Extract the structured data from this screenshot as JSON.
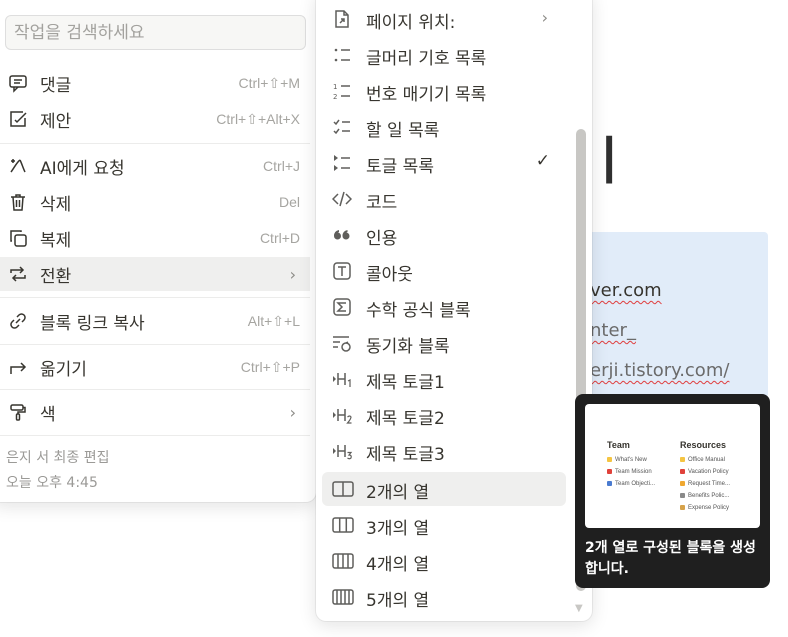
{
  "background": {
    "heading_fragment": "ㅣ",
    "links": [
      "ver.com",
      "nter_",
      "erji.tistory.com/"
    ]
  },
  "left_menu": {
    "search_placeholder": "작업을 검색하세요",
    "items": [
      {
        "label": "댓글",
        "shortcut": "Ctrl+⇧+M"
      },
      {
        "label": "제안",
        "shortcut": "Ctrl+⇧+Alt+X"
      },
      {
        "label": "AI에게 요청",
        "shortcut": "Ctrl+J"
      },
      {
        "label": "삭제",
        "shortcut": "Del"
      },
      {
        "label": "복제",
        "shortcut": "Ctrl+D"
      },
      {
        "label": "전환",
        "shortcut": ""
      },
      {
        "label": "블록 링크 복사",
        "shortcut": "Alt+⇧+L"
      },
      {
        "label": "옮기기",
        "shortcut": "Ctrl+⇧+P"
      },
      {
        "label": "색",
        "shortcut": ""
      }
    ],
    "footer": {
      "editor": "은지 서 최종 편집",
      "time": "오늘 오후 4:45"
    }
  },
  "turn_into_menu": {
    "items": [
      {
        "label": "페이지 위치:"
      },
      {
        "label": "글머리 기호 목록"
      },
      {
        "label": "번호 매기기 목록"
      },
      {
        "label": "할 일 목록"
      },
      {
        "label": "토글 목록"
      },
      {
        "label": "코드"
      },
      {
        "label": "인용"
      },
      {
        "label": "콜아웃"
      },
      {
        "label": "수학 공식 블록"
      },
      {
        "label": "동기화 블록"
      },
      {
        "label": "제목 토글1"
      },
      {
        "label": "제목 토글2"
      },
      {
        "label": "제목 토글3"
      },
      {
        "label": "2개의 열"
      },
      {
        "label": "3개의 열"
      },
      {
        "label": "4개의 열"
      },
      {
        "label": "5개의 열"
      }
    ],
    "checkmark": "✓",
    "active_index": 13
  },
  "tooltip": {
    "preview": {
      "col1_title": "Team",
      "col1_items": [
        "What's New",
        "Team Mission",
        "Team Objecti..."
      ],
      "col2_title": "Resources",
      "col2_items": [
        "Office Manual",
        "Vacation Policy",
        "Request Time...",
        "Benefits Polic...",
        "Expense Policy"
      ]
    },
    "description": "2개 열로 구성된 블록을 생성합니다."
  },
  "colors": {
    "accent_bg": "#e1ecf9",
    "hover": "#efefee",
    "text": "#37352f",
    "muted": "#a6a5a1"
  }
}
